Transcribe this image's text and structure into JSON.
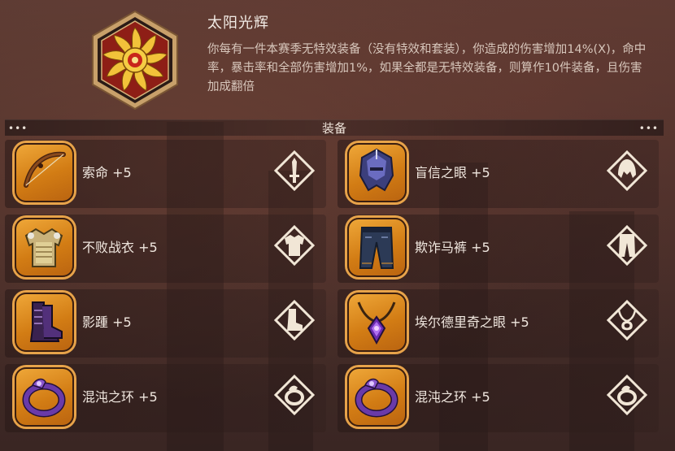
{
  "skill": {
    "title": "太阳光辉",
    "description": "你每有一件本赛季无特效装备（没有特效和套装），你造成的伤害增加14%(X)，命中率，暴击率和全部伤害增加1%，如果全都是无特效装备，则算作10件装备，且伤害加成翻倍",
    "icon": "sun-emblem-icon"
  },
  "section": {
    "title": "装备",
    "left_ornament": "•••",
    "right_ornament": "•••"
  },
  "equipment": [
    {
      "label": "索命 +5",
      "item_icon": "bow-icon",
      "slot_icon": "weapon-slot-icon"
    },
    {
      "label": "盲信之眼 +5",
      "item_icon": "helmet-icon",
      "slot_icon": "helmet-slot-icon"
    },
    {
      "label": "不败战衣 +5",
      "item_icon": "armor-icon",
      "slot_icon": "armor-slot-icon"
    },
    {
      "label": "欺诈马裤 +5",
      "item_icon": "pants-icon",
      "slot_icon": "pants-slot-icon"
    },
    {
      "label": "影踵 +5",
      "item_icon": "boots-icon",
      "slot_icon": "boots-slot-icon"
    },
    {
      "label": "埃尔德里奇之眼 +5",
      "item_icon": "amulet-icon",
      "slot_icon": "necklace-slot-icon"
    },
    {
      "label": "混沌之环 +5",
      "item_icon": "ring-icon",
      "slot_icon": "ring-slot-icon"
    },
    {
      "label": "混沌之环 +5",
      "item_icon": "ring-icon",
      "slot_icon": "ring-slot-icon"
    }
  ],
  "colors": {
    "frame_orange": "#e08a1f",
    "badge_red": "#8e1e16",
    "text_light": "#f0e7df"
  }
}
